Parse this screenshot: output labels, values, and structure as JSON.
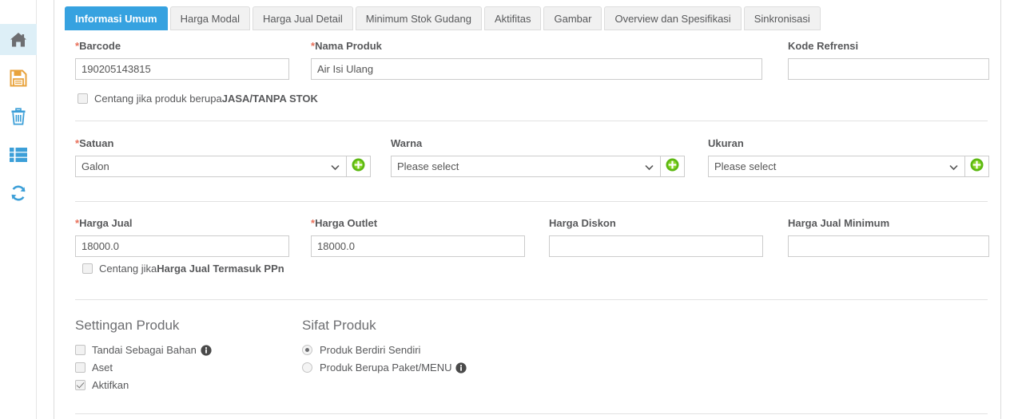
{
  "sidebar": {
    "items": [
      {
        "name": "home",
        "icon": "home-icon",
        "active": true
      },
      {
        "name": "save",
        "icon": "save-icon",
        "active": false
      },
      {
        "name": "delete",
        "icon": "trash-icon",
        "active": false
      },
      {
        "name": "list",
        "icon": "list-icon",
        "active": false
      },
      {
        "name": "sync",
        "icon": "refresh-icon",
        "active": false
      }
    ]
  },
  "tabs": [
    {
      "label": "Informasi Umum",
      "active": true
    },
    {
      "label": "Harga Modal",
      "active": false
    },
    {
      "label": "Harga Jual Detail",
      "active": false
    },
    {
      "label": "Minimum Stok Gudang",
      "active": false
    },
    {
      "label": "Aktifitas",
      "active": false
    },
    {
      "label": "Gambar",
      "active": false
    },
    {
      "label": "Overview dan Spesifikasi",
      "active": false
    },
    {
      "label": "Sinkronisasi",
      "active": false
    }
  ],
  "form": {
    "barcode": {
      "label": "Barcode",
      "required": true,
      "value": "190205143815",
      "placeholder": ""
    },
    "nama_produk": {
      "label": "Nama Produk",
      "required": true,
      "value": "Air Isi Ulang",
      "placeholder": ""
    },
    "kode_refrensi": {
      "label": "Kode Refrensi",
      "required": false,
      "value": "",
      "placeholder": ""
    },
    "jasa_checkbox": {
      "text_plain": "Centang jika produk berupa ",
      "text_strong": "JASA/TANPA STOK",
      "checked": false
    },
    "satuan": {
      "label": "Satuan",
      "required": true,
      "value": "Galon"
    },
    "warna": {
      "label": "Warna",
      "required": false,
      "value": "Please select"
    },
    "ukuran": {
      "label": "Ukuran",
      "required": false,
      "value": "Please select"
    },
    "harga_jual": {
      "label": "Harga Jual",
      "required": true,
      "value": "18000.0",
      "placeholder": ""
    },
    "harga_outlet": {
      "label": "Harga Outlet",
      "required": true,
      "value": "18000.0",
      "placeholder": ""
    },
    "harga_diskon": {
      "label": "Harga Diskon",
      "required": false,
      "value": "",
      "placeholder": ""
    },
    "harga_jual_minimum": {
      "label": "Harga Jual Minimum",
      "required": false,
      "value": "",
      "placeholder": ""
    },
    "ppn_checkbox": {
      "text_plain": "Centang jika ",
      "text_strong": "Harga Jual Termasuk PPn",
      "checked": false
    },
    "settingan_produk": {
      "title": "Settingan Produk",
      "options": [
        {
          "label": "Tandai Sebagai Bahan",
          "checked": false,
          "info": true
        },
        {
          "label": "Aset",
          "checked": false,
          "info": false
        },
        {
          "label": "Aktifkan",
          "checked": true,
          "info": false
        }
      ]
    },
    "sifat_produk": {
      "title": "Sifat Produk",
      "options": [
        {
          "label": "Produk Berdiri Sendiri",
          "selected": true,
          "info": false
        },
        {
          "label": "Produk Berupa Paket/MENU",
          "selected": false,
          "info": true
        }
      ]
    }
  },
  "colors": {
    "tab_active_bg": "#36a2e0",
    "required_star": "#e8705a",
    "plus_green": "#5cb811",
    "rail_home_active_bg": "#ddeff7",
    "rail_save": "#e8a33d",
    "rail_blue": "#3c9fd8",
    "label_text": "#58595b"
  }
}
